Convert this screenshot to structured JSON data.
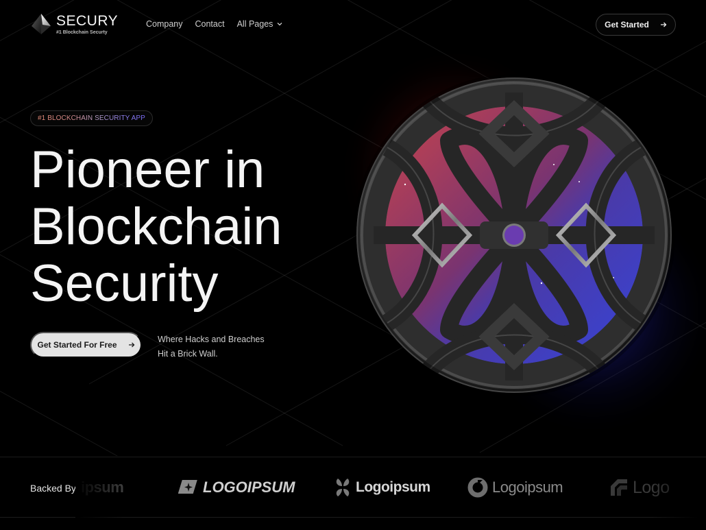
{
  "brand": {
    "name": "SECURY",
    "tagline": "#1 Blockchain Securty"
  },
  "nav": {
    "links": [
      {
        "label": "Company"
      },
      {
        "label": "Contact"
      },
      {
        "label": "All Pages",
        "has_dropdown": true
      }
    ],
    "cta_label": "Get Started",
    "cta_icon": "arrow-right-icon"
  },
  "hero": {
    "badge": "#1 BLOCKCHAIN SECURITY APP",
    "title_lines": [
      "Pioneer in",
      "Blockchain",
      "Security"
    ],
    "primary_cta_label": "Get Started For Free",
    "primary_cta_icon": "arrow-right-icon",
    "tagline_lines": [
      "Where Hacks and Breaches",
      "Hit a Brick Wall."
    ],
    "visual": "armored-sphere-illustration"
  },
  "backers": {
    "label": "Backed By",
    "logos": [
      {
        "text": "ipsum",
        "icon": "none"
      },
      {
        "text": "LOGOIPSUM",
        "icon": "sparkle-square-icon"
      },
      {
        "text": "Logoipsum",
        "icon": "petal-cluster-icon"
      },
      {
        "text": "Logoipsum",
        "icon": "ring-icon"
      },
      {
        "text": "Logo",
        "icon": "stepped-corner-icon"
      }
    ]
  },
  "colors": {
    "background": "#000000",
    "badge_gradient_start": "#e58a77",
    "badge_gradient_end": "#7a6cf5",
    "primary_button_bg": "#e4e4e4",
    "sphere_red": "#b8424a",
    "sphere_blue": "#3b46c8",
    "sphere_core": "#6a3cb0"
  }
}
